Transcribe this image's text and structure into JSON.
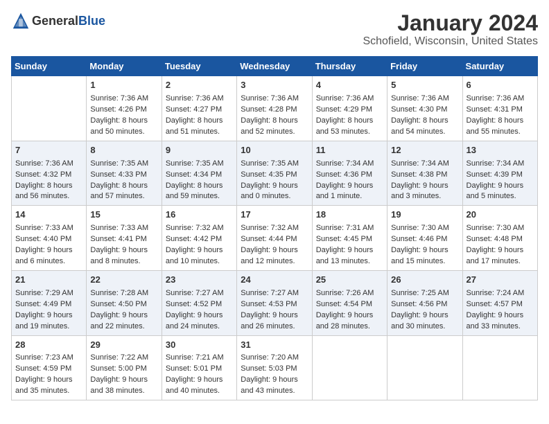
{
  "logo": {
    "general": "General",
    "blue": "Blue"
  },
  "title": "January 2024",
  "subtitle": "Schofield, Wisconsin, United States",
  "days_of_week": [
    "Sunday",
    "Monday",
    "Tuesday",
    "Wednesday",
    "Thursday",
    "Friday",
    "Saturday"
  ],
  "weeks": [
    [
      {
        "day": "",
        "info": ""
      },
      {
        "day": "1",
        "info": "Sunrise: 7:36 AM\nSunset: 4:26 PM\nDaylight: 8 hours\nand 50 minutes."
      },
      {
        "day": "2",
        "info": "Sunrise: 7:36 AM\nSunset: 4:27 PM\nDaylight: 8 hours\nand 51 minutes."
      },
      {
        "day": "3",
        "info": "Sunrise: 7:36 AM\nSunset: 4:28 PM\nDaylight: 8 hours\nand 52 minutes."
      },
      {
        "day": "4",
        "info": "Sunrise: 7:36 AM\nSunset: 4:29 PM\nDaylight: 8 hours\nand 53 minutes."
      },
      {
        "day": "5",
        "info": "Sunrise: 7:36 AM\nSunset: 4:30 PM\nDaylight: 8 hours\nand 54 minutes."
      },
      {
        "day": "6",
        "info": "Sunrise: 7:36 AM\nSunset: 4:31 PM\nDaylight: 8 hours\nand 55 minutes."
      }
    ],
    [
      {
        "day": "7",
        "info": "Sunrise: 7:36 AM\nSunset: 4:32 PM\nDaylight: 8 hours\nand 56 minutes."
      },
      {
        "day": "8",
        "info": "Sunrise: 7:35 AM\nSunset: 4:33 PM\nDaylight: 8 hours\nand 57 minutes."
      },
      {
        "day": "9",
        "info": "Sunrise: 7:35 AM\nSunset: 4:34 PM\nDaylight: 8 hours\nand 59 minutes."
      },
      {
        "day": "10",
        "info": "Sunrise: 7:35 AM\nSunset: 4:35 PM\nDaylight: 9 hours\nand 0 minutes."
      },
      {
        "day": "11",
        "info": "Sunrise: 7:34 AM\nSunset: 4:36 PM\nDaylight: 9 hours\nand 1 minute."
      },
      {
        "day": "12",
        "info": "Sunrise: 7:34 AM\nSunset: 4:38 PM\nDaylight: 9 hours\nand 3 minutes."
      },
      {
        "day": "13",
        "info": "Sunrise: 7:34 AM\nSunset: 4:39 PM\nDaylight: 9 hours\nand 5 minutes."
      }
    ],
    [
      {
        "day": "14",
        "info": "Sunrise: 7:33 AM\nSunset: 4:40 PM\nDaylight: 9 hours\nand 6 minutes."
      },
      {
        "day": "15",
        "info": "Sunrise: 7:33 AM\nSunset: 4:41 PM\nDaylight: 9 hours\nand 8 minutes."
      },
      {
        "day": "16",
        "info": "Sunrise: 7:32 AM\nSunset: 4:42 PM\nDaylight: 9 hours\nand 10 minutes."
      },
      {
        "day": "17",
        "info": "Sunrise: 7:32 AM\nSunset: 4:44 PM\nDaylight: 9 hours\nand 12 minutes."
      },
      {
        "day": "18",
        "info": "Sunrise: 7:31 AM\nSunset: 4:45 PM\nDaylight: 9 hours\nand 13 minutes."
      },
      {
        "day": "19",
        "info": "Sunrise: 7:30 AM\nSunset: 4:46 PM\nDaylight: 9 hours\nand 15 minutes."
      },
      {
        "day": "20",
        "info": "Sunrise: 7:30 AM\nSunset: 4:48 PM\nDaylight: 9 hours\nand 17 minutes."
      }
    ],
    [
      {
        "day": "21",
        "info": "Sunrise: 7:29 AM\nSunset: 4:49 PM\nDaylight: 9 hours\nand 19 minutes."
      },
      {
        "day": "22",
        "info": "Sunrise: 7:28 AM\nSunset: 4:50 PM\nDaylight: 9 hours\nand 22 minutes."
      },
      {
        "day": "23",
        "info": "Sunrise: 7:27 AM\nSunset: 4:52 PM\nDaylight: 9 hours\nand 24 minutes."
      },
      {
        "day": "24",
        "info": "Sunrise: 7:27 AM\nSunset: 4:53 PM\nDaylight: 9 hours\nand 26 minutes."
      },
      {
        "day": "25",
        "info": "Sunrise: 7:26 AM\nSunset: 4:54 PM\nDaylight: 9 hours\nand 28 minutes."
      },
      {
        "day": "26",
        "info": "Sunrise: 7:25 AM\nSunset: 4:56 PM\nDaylight: 9 hours\nand 30 minutes."
      },
      {
        "day": "27",
        "info": "Sunrise: 7:24 AM\nSunset: 4:57 PM\nDaylight: 9 hours\nand 33 minutes."
      }
    ],
    [
      {
        "day": "28",
        "info": "Sunrise: 7:23 AM\nSunset: 4:59 PM\nDaylight: 9 hours\nand 35 minutes."
      },
      {
        "day": "29",
        "info": "Sunrise: 7:22 AM\nSunset: 5:00 PM\nDaylight: 9 hours\nand 38 minutes."
      },
      {
        "day": "30",
        "info": "Sunrise: 7:21 AM\nSunset: 5:01 PM\nDaylight: 9 hours\nand 40 minutes."
      },
      {
        "day": "31",
        "info": "Sunrise: 7:20 AM\nSunset: 5:03 PM\nDaylight: 9 hours\nand 43 minutes."
      },
      {
        "day": "",
        "info": ""
      },
      {
        "day": "",
        "info": ""
      },
      {
        "day": "",
        "info": ""
      }
    ]
  ]
}
